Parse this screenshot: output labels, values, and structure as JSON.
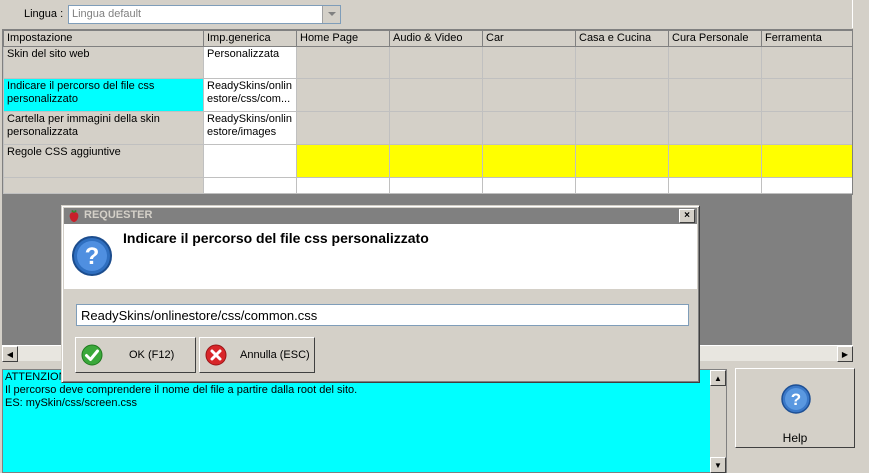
{
  "toolbar": {
    "lingua_label": "Lingua :",
    "lingua_value": "Lingua default"
  },
  "grid": {
    "columns": [
      "Impostazione",
      "Imp.generica",
      "Home Page",
      "Audio & Video",
      "Car",
      "Casa e Cucina",
      "Cura Personale",
      "Ferramenta"
    ],
    "rows": [
      {
        "setting": "Skin del sito web",
        "generic": "Personalizzata"
      },
      {
        "setting": "Indicare il percorso del file css personalizzato",
        "generic": "ReadySkins/onlinestore/css/com..."
      },
      {
        "setting": "Cartella per immagini della skin personalizzata",
        "generic": "ReadySkins/onlinestore/images"
      },
      {
        "setting": "Regole CSS aggiuntive",
        "generic": ""
      }
    ]
  },
  "info": {
    "lines": [
      "ATTENZIONE",
      "Il percorso deve comprendere il nome del file a partire dalla root del sito.",
      "ES: mySkin/css/screen.css"
    ]
  },
  "help": {
    "label": "Help"
  },
  "dialog": {
    "title": "REQUESTER",
    "message": "Indicare il percorso del file css personalizzato",
    "input_value": "ReadySkins/onlinestore/css/common.css",
    "ok_label": "OK (F12)",
    "cancel_label": "Annulla (ESC)",
    "close_label": "×"
  },
  "colors": {
    "selected": "#00ffff",
    "highlight": "#ffff00",
    "titlebar": "#808080"
  }
}
